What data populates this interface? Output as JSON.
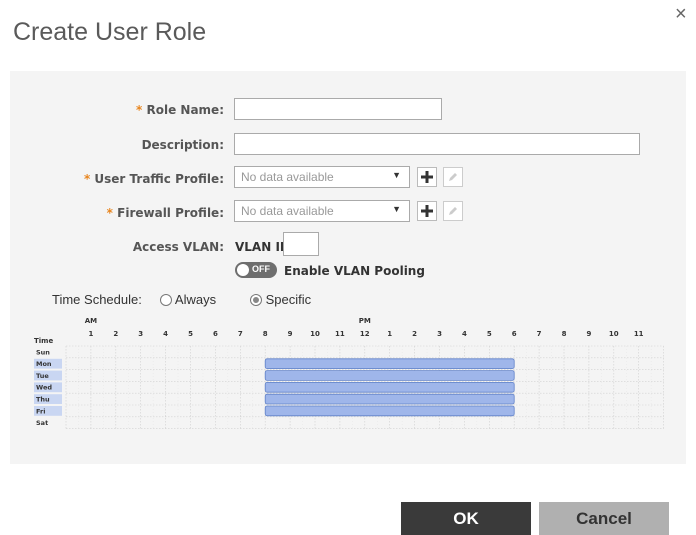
{
  "dialog": {
    "title": "Create User Role",
    "close_glyph": "×"
  },
  "form": {
    "required_mark": "*",
    "role_name": {
      "label": "Role Name:",
      "value": ""
    },
    "description": {
      "label": "Description:",
      "value": ""
    },
    "user_traffic_profile": {
      "label": "User Traffic Profile:",
      "value": "No data available"
    },
    "firewall_profile": {
      "label": "Firewall Profile:",
      "value": "No data available"
    },
    "access_vlan": {
      "label": "Access VLAN:",
      "vlan_id_label": "VLAN ID",
      "vlan_id_value": ""
    },
    "vlan_pooling": {
      "toggle_text": "OFF",
      "label": "Enable VLAN Pooling",
      "enabled": false
    }
  },
  "schedule": {
    "label": "Time Schedule:",
    "option_always": "Always",
    "option_specific": "Specific",
    "selected": "Specific",
    "time_header": "Time",
    "am_label": "AM",
    "pm_label": "PM",
    "hours": [
      "1",
      "2",
      "3",
      "4",
      "5",
      "6",
      "7",
      "8",
      "9",
      "10",
      "11",
      "12",
      "1",
      "2",
      "3",
      "4",
      "5",
      "6",
      "7",
      "8",
      "9",
      "10",
      "11"
    ],
    "days": [
      "Sun",
      "Mon",
      "Tue",
      "Wed",
      "Thu",
      "Fri",
      "Sat"
    ],
    "active_days": [
      "Mon",
      "Tue",
      "Wed",
      "Thu",
      "Fri"
    ],
    "active_start_hour": 8,
    "active_end_hour": 18,
    "active_color": "#9fb6ea",
    "active_border": "#5f80c8"
  },
  "footer": {
    "ok_label": "OK",
    "cancel_label": "Cancel"
  }
}
